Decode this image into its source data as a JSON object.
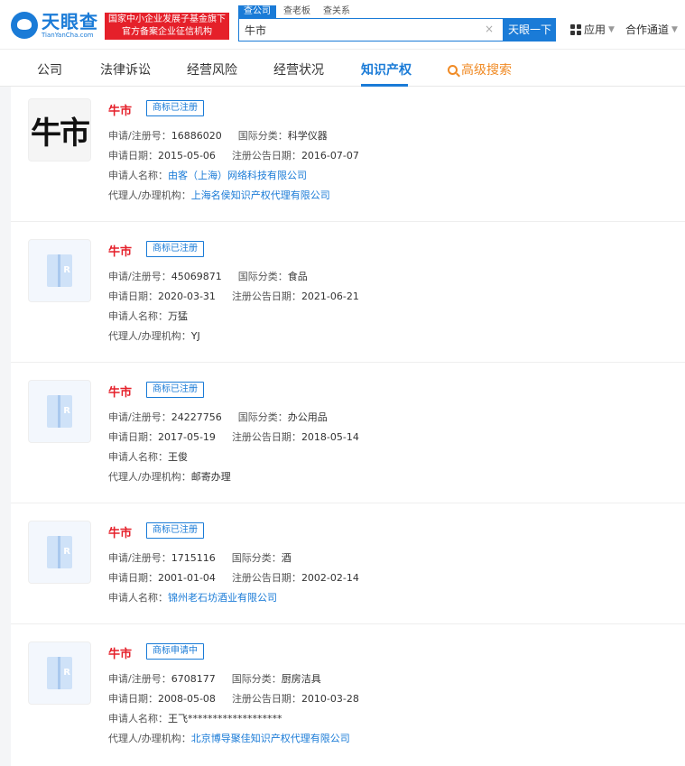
{
  "header": {
    "logo_cn": "天眼查",
    "logo_en": "TianYanCha.com",
    "badge_line1": "国家中小企业发展子基金旗下",
    "badge_line2": "官方备案企业征信机构",
    "search_tabs": [
      "查公司",
      "查老板",
      "查关系"
    ],
    "search_value": "牛市",
    "search_button": "天眼一下",
    "apps_label": "应用",
    "partner_label": "合作通道"
  },
  "nav": {
    "items": [
      "公司",
      "法律诉讼",
      "经营风险",
      "经营状况",
      "知识产权"
    ],
    "active": "知识产权",
    "advanced": "高级搜索"
  },
  "labels": {
    "reg_no": "申请/注册号：",
    "intl_class": "国际分类：",
    "apply_date": "申请日期：",
    "notice_date": "注册公告日期：",
    "applicant": "申请人名称：",
    "agent": "代理人/办理机构："
  },
  "cards": [
    {
      "title": "牛市",
      "status": "商标已注册",
      "thumb_text": "牛市",
      "reg_no": "16886020",
      "intl_class": "科学仪器",
      "apply_date": "2015-05-06",
      "notice_date": "2016-07-07",
      "applicant": "由客（上海）网络科技有限公司",
      "agent": "上海名侯知识产权代理有限公司"
    },
    {
      "title": "牛市",
      "status": "商标已注册",
      "reg_no": "45069871",
      "intl_class": "食品",
      "apply_date": "2020-03-31",
      "notice_date": "2021-06-21",
      "applicant": "万猛",
      "agent": "YJ"
    },
    {
      "title": "牛市",
      "status": "商标已注册",
      "reg_no": "24227756",
      "intl_class": "办公用品",
      "apply_date": "2017-05-19",
      "notice_date": "2018-05-14",
      "applicant": "王俊",
      "agent": "邮寄办理"
    },
    {
      "title": "牛市",
      "status": "商标已注册",
      "reg_no": "1715116",
      "intl_class": "酒",
      "apply_date": "2001-01-04",
      "notice_date": "2002-02-14",
      "applicant": "锦州老石坊酒业有限公司"
    },
    {
      "title": "牛市",
      "status": "商标申请中",
      "reg_no": "6708177",
      "intl_class": "厨房洁具",
      "apply_date": "2008-05-08",
      "notice_date": "2010-03-28",
      "applicant": "王飞*******************",
      "agent": "北京博导聚佳知识产权代理有限公司"
    }
  ],
  "colors": {
    "brand_blue": "#1a7bd7",
    "title_red": "#e5202a",
    "advanced_orange": "#f08a24"
  }
}
